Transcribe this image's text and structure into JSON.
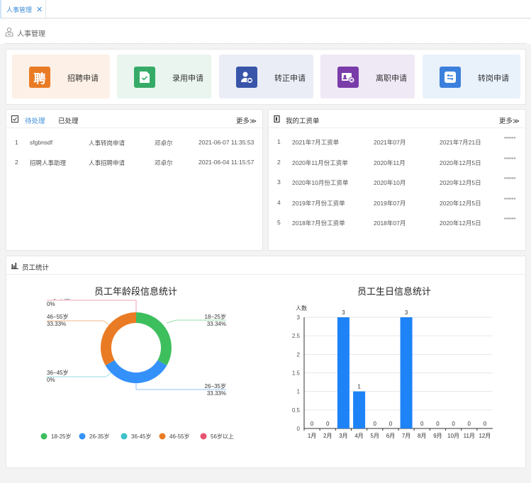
{
  "tabbar": {
    "active_tab": "人事管理",
    "close_icon": "close-icon"
  },
  "page": {
    "title": "人事管理",
    "icon": "user-icon"
  },
  "quick_actions": [
    {
      "label": "招聘申请",
      "icon": "recruit-icon",
      "glyph": "聘",
      "bg": "#fdf0e6",
      "icon_bg": "#ea7b25"
    },
    {
      "label": "录用申请",
      "icon": "hire-document-icon",
      "bg": "#e9f5ee",
      "icon_bg": "#36ab68"
    },
    {
      "label": "转正申请",
      "icon": "regularization-user-icon",
      "bg": "#eaedf6",
      "icon_bg": "#3955a9"
    },
    {
      "label": "离职申请",
      "icon": "resignation-card-icon",
      "bg": "#efe8f5",
      "icon_bg": "#7a3ca9"
    },
    {
      "label": "转岗申请",
      "icon": "transfer-arrows-icon",
      "bg": "#e9f1fb",
      "icon_bg": "#3b80dc"
    }
  ],
  "tasks": {
    "tabs": [
      "待处理",
      "已处理"
    ],
    "active_tab": "待处理",
    "more": "更多≫",
    "rows": [
      {
        "no": "1",
        "title": "sfgbnsdf",
        "type": "人事转岗申请",
        "person": "邓卓尔",
        "time": "2021-06-07 11:35:53"
      },
      {
        "no": "2",
        "title": "招聘人事助理",
        "type": "人事招聘申请",
        "person": "邓卓尔",
        "time": "2021-06-04 11:15:57"
      }
    ]
  },
  "payroll": {
    "title": "我的工资单",
    "more": "更多≫",
    "rows": [
      {
        "no": "1",
        "name": "2021年7月工资单",
        "month": "2021年07月",
        "date": "2021年7月21日",
        "amount": "******"
      },
      {
        "no": "2",
        "name": "2020年11月份工资单",
        "month": "2020年11月",
        "date": "2020年12月5日",
        "amount": "******"
      },
      {
        "no": "3",
        "name": "2020年10月份工资单",
        "month": "2020年10月",
        "date": "2020年12月5日",
        "amount": "******"
      },
      {
        "no": "4",
        "name": "2019年7月份工资单",
        "month": "2019年07月",
        "date": "2020年12月5日",
        "amount": "******"
      },
      {
        "no": "5",
        "name": "2018年7月份工资单",
        "month": "2018年07月",
        "date": "2020年12月5日",
        "amount": "******"
      }
    ]
  },
  "stats": {
    "title": "员工统计"
  },
  "chart_data": [
    {
      "type": "pie",
      "title": "员工年龄段信息统计",
      "donut": true,
      "categories": [
        "18-25岁",
        "26-35岁",
        "36-45岁",
        "46-55岁",
        "56岁以上"
      ],
      "values": [
        1,
        1,
        0,
        1,
        0
      ],
      "percent_labels": [
        "33.34%",
        "33.33%",
        "0%",
        "33.33%",
        "0%"
      ],
      "colors": [
        "#3dbf5e",
        "#3491fa",
        "#3cc2c8",
        "#ea7b25",
        "#e8536f"
      ],
      "legend": "bottom"
    },
    {
      "type": "bar",
      "title": "员工生日信息统计",
      "ylabel": "人数",
      "xlabel": "",
      "categories": [
        "1月",
        "2月",
        "3月",
        "4月",
        "5月",
        "6月",
        "7月",
        "8月",
        "9月",
        "10月",
        "11月",
        "12月"
      ],
      "values": [
        0,
        0,
        3,
        1,
        0,
        0,
        3,
        0,
        0,
        0,
        0,
        0
      ],
      "ylim": [
        0,
        3
      ],
      "yticks": [
        0,
        0.5,
        1,
        1.5,
        2,
        2.5,
        3
      ],
      "grid": true,
      "color": "#1e83f7"
    }
  ]
}
